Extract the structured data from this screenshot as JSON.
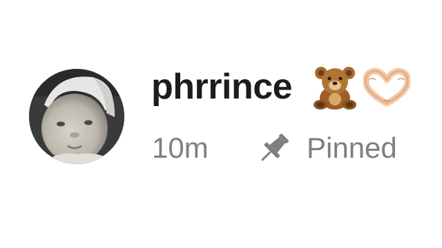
{
  "post_header": {
    "username": "phrrince",
    "username_emojis": [
      "teddy-bear-emoji",
      "heart-hands-emoji"
    ],
    "timestamp": "10m",
    "pinned_label": "Pinned",
    "pin_icon": "pushpin-icon",
    "avatar_icon": "profile-avatar"
  },
  "colors": {
    "username_text": "#1c1c1c",
    "meta_text": "#7f7f7f",
    "icon": "#7f7f7f",
    "background": "#ffffff"
  }
}
